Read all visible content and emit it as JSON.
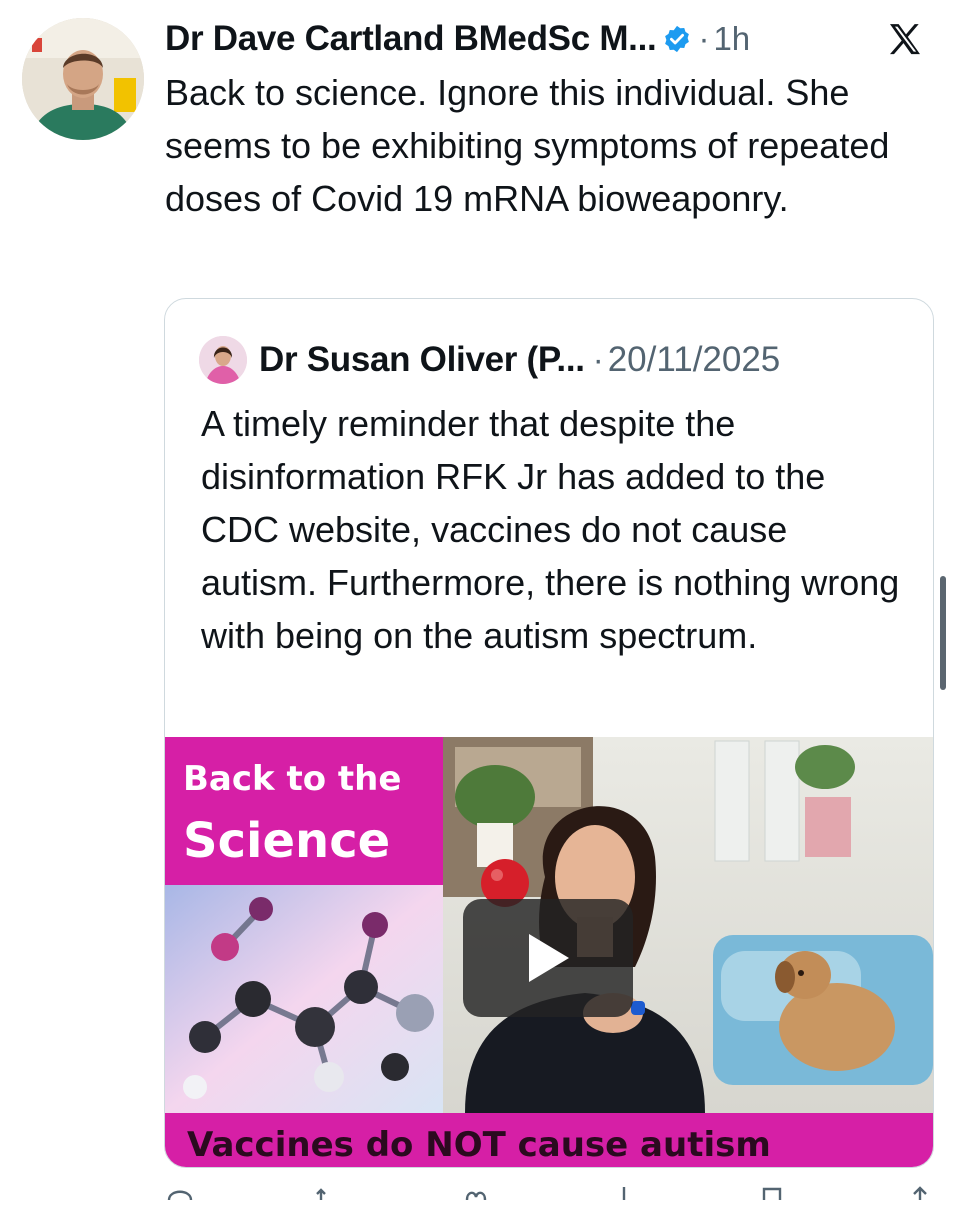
{
  "tweet": {
    "author_name": "Dr Dave Cartland BMedSc M...",
    "separator": "·",
    "time": "1h",
    "text": "Back to science. Ignore this individual. She seems to be exhibiting symptoms of repeated doses of Covid 19 mRNA bioweaponry.",
    "icons": [
      "avatar",
      "verified-badge-icon",
      "x-logo-icon"
    ]
  },
  "quoted_tweet": {
    "author_name": "Dr Susan Oliver (P...",
    "separator": "·",
    "date": "20/11/2025",
    "text": "A timely reminder that despite the disinformation RFK Jr has added to the CDC website, vaccines do not cause autism. Furthermore, there is nothing wrong with being on the autism spectrum.",
    "media": {
      "type": "video-thumbnail",
      "title_line1": "Back to the",
      "title_line2": "Science",
      "caption": "Vaccines do NOT cause autism",
      "accent_color": "#d61fa6",
      "icons": [
        "play-icon"
      ]
    }
  },
  "colors": {
    "text_primary": "#0f1419",
    "text_secondary": "#536471",
    "verified_blue": "#1d9bf0",
    "border": "#cfd9de"
  }
}
